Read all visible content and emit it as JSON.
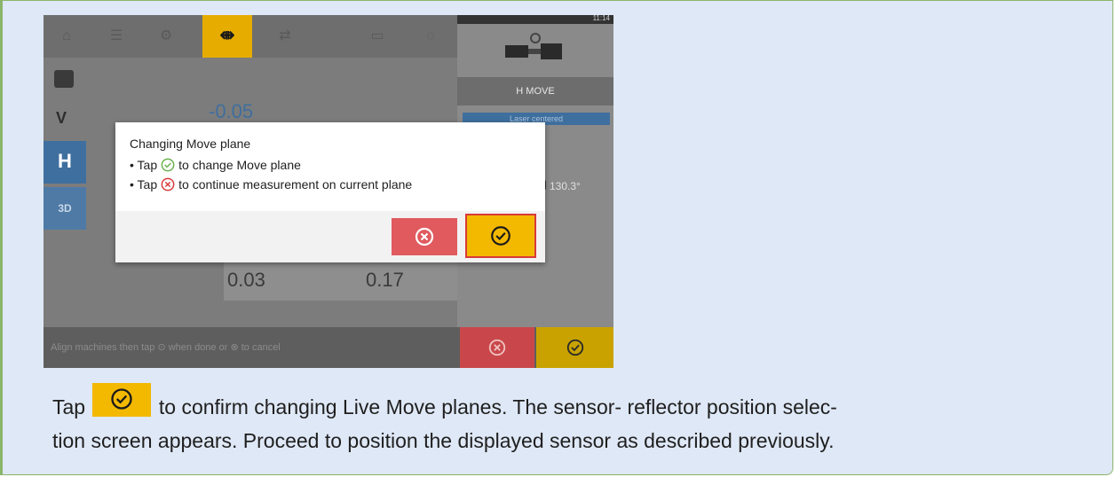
{
  "screen": {
    "top_tabs": [
      "home-icon",
      "list-icon",
      "settings-icon",
      "machine-icon",
      "flip-icon",
      "battery-icon",
      "chat-icon"
    ],
    "side_panel": {
      "mode_title": "H MOVE",
      "laser_status": "Laser centered",
      "angle": "130.3°"
    },
    "left_nav": {
      "v_label": "V",
      "h_label": "H",
      "3d_label": "3D"
    },
    "background_values": {
      "top_value": "-0.05",
      "bottom_left": "0.03",
      "bottom_right": "0.17"
    },
    "bottom_hint": "Align machines then tap ⊙ when done or ⊗ to cancel",
    "colors": {
      "accent_yellow": "#f3b800",
      "cancel_red": "#e05a5e",
      "nav_blue": "#3f6f9e",
      "confirm_green": "#6ab04c"
    }
  },
  "dialog": {
    "title": "Changing Move plane",
    "line1_prefix": "• Tap",
    "line1_suffix": "to change Move plane",
    "line2_prefix": "• Tap",
    "line2_suffix": "to continue measurement on current plane",
    "cancel_icon": "cancel-circle-icon",
    "confirm_icon": "check-circle-icon"
  },
  "caption": {
    "before": "Tap",
    "after": "to confirm changing Live Move planes. The sensor- reflector position selec-",
    "line2": "tion screen appears. Proceed to position the displayed sensor as described previously."
  }
}
